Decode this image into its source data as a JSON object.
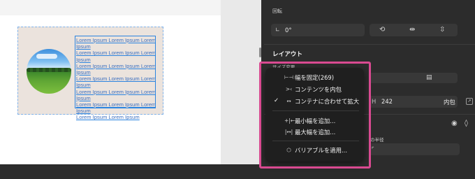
{
  "canvas": {
    "lorem_lines": [
      "Lorem Ipsum Lorem Ipsum Lorem",
      "Ipsum",
      "Lorem Ipsum Lorem Ipsum Lorem",
      "Ipsum",
      "Lorem Ipsum Lorem Ipsum Lorem",
      "Ipsum",
      "Lorem Ipsum Lorem Ipsum Lorem",
      "Ipsum",
      "Lorem Ipsum Lorem Ipsum Lorem",
      "Ipsum",
      "Lorem Ipsum Lorem Ipsum Lorem",
      "Ipsum",
      "Lorem Ipsum Lorem Ipsum"
    ]
  },
  "panel": {
    "rotation_label": "回転",
    "rotation_value": "0°",
    "layout_heading": "レイアウト",
    "resize_label": "サイズ変更",
    "height_prefix": "H",
    "height_value": "242",
    "height_mode": "内包",
    "radius_label_partial": "の半径",
    "accent_color": "#d94a91"
  },
  "menu": {
    "items": [
      {
        "icon": "⊢⊣",
        "label": "幅を固定(269)",
        "checked": false
      },
      {
        "icon": ">‹",
        "label": "コンテンツを内包",
        "checked": false
      },
      {
        "icon": "↔",
        "label": "コンテナに合わせて拡大",
        "checked": true
      },
      {
        "icon": "+|←",
        "label": "最小幅を追加...",
        "checked": false
      },
      {
        "icon": "|↔|",
        "label": "最大幅を追加...",
        "checked": false
      },
      {
        "icon": "⬡",
        "label": "バリアブルを適用...",
        "checked": false
      }
    ],
    "check_glyph": "✓"
  }
}
